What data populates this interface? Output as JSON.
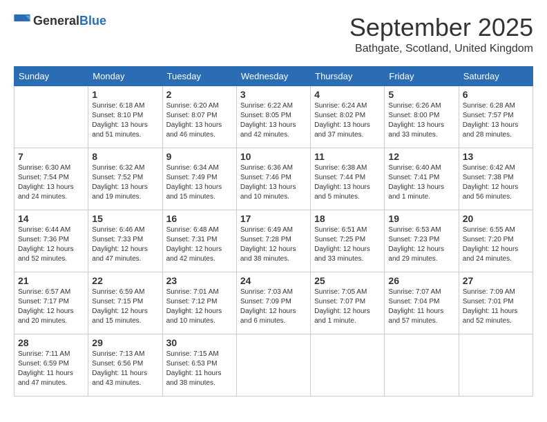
{
  "logo": {
    "general": "General",
    "blue": "Blue"
  },
  "title": "September 2025",
  "location": "Bathgate, Scotland, United Kingdom",
  "days_of_week": [
    "Sunday",
    "Monday",
    "Tuesday",
    "Wednesday",
    "Thursday",
    "Friday",
    "Saturday"
  ],
  "weeks": [
    [
      {
        "day": "",
        "info": ""
      },
      {
        "day": "1",
        "info": "Sunrise: 6:18 AM\nSunset: 8:10 PM\nDaylight: 13 hours\nand 51 minutes."
      },
      {
        "day": "2",
        "info": "Sunrise: 6:20 AM\nSunset: 8:07 PM\nDaylight: 13 hours\nand 46 minutes."
      },
      {
        "day": "3",
        "info": "Sunrise: 6:22 AM\nSunset: 8:05 PM\nDaylight: 13 hours\nand 42 minutes."
      },
      {
        "day": "4",
        "info": "Sunrise: 6:24 AM\nSunset: 8:02 PM\nDaylight: 13 hours\nand 37 minutes."
      },
      {
        "day": "5",
        "info": "Sunrise: 6:26 AM\nSunset: 8:00 PM\nDaylight: 13 hours\nand 33 minutes."
      },
      {
        "day": "6",
        "info": "Sunrise: 6:28 AM\nSunset: 7:57 PM\nDaylight: 13 hours\nand 28 minutes."
      }
    ],
    [
      {
        "day": "7",
        "info": "Sunrise: 6:30 AM\nSunset: 7:54 PM\nDaylight: 13 hours\nand 24 minutes."
      },
      {
        "day": "8",
        "info": "Sunrise: 6:32 AM\nSunset: 7:52 PM\nDaylight: 13 hours\nand 19 minutes."
      },
      {
        "day": "9",
        "info": "Sunrise: 6:34 AM\nSunset: 7:49 PM\nDaylight: 13 hours\nand 15 minutes."
      },
      {
        "day": "10",
        "info": "Sunrise: 6:36 AM\nSunset: 7:46 PM\nDaylight: 13 hours\nand 10 minutes."
      },
      {
        "day": "11",
        "info": "Sunrise: 6:38 AM\nSunset: 7:44 PM\nDaylight: 13 hours\nand 5 minutes."
      },
      {
        "day": "12",
        "info": "Sunrise: 6:40 AM\nSunset: 7:41 PM\nDaylight: 13 hours\nand 1 minute."
      },
      {
        "day": "13",
        "info": "Sunrise: 6:42 AM\nSunset: 7:38 PM\nDaylight: 12 hours\nand 56 minutes."
      }
    ],
    [
      {
        "day": "14",
        "info": "Sunrise: 6:44 AM\nSunset: 7:36 PM\nDaylight: 12 hours\nand 52 minutes."
      },
      {
        "day": "15",
        "info": "Sunrise: 6:46 AM\nSunset: 7:33 PM\nDaylight: 12 hours\nand 47 minutes."
      },
      {
        "day": "16",
        "info": "Sunrise: 6:48 AM\nSunset: 7:31 PM\nDaylight: 12 hours\nand 42 minutes."
      },
      {
        "day": "17",
        "info": "Sunrise: 6:49 AM\nSunset: 7:28 PM\nDaylight: 12 hours\nand 38 minutes."
      },
      {
        "day": "18",
        "info": "Sunrise: 6:51 AM\nSunset: 7:25 PM\nDaylight: 12 hours\nand 33 minutes."
      },
      {
        "day": "19",
        "info": "Sunrise: 6:53 AM\nSunset: 7:23 PM\nDaylight: 12 hours\nand 29 minutes."
      },
      {
        "day": "20",
        "info": "Sunrise: 6:55 AM\nSunset: 7:20 PM\nDaylight: 12 hours\nand 24 minutes."
      }
    ],
    [
      {
        "day": "21",
        "info": "Sunrise: 6:57 AM\nSunset: 7:17 PM\nDaylight: 12 hours\nand 20 minutes."
      },
      {
        "day": "22",
        "info": "Sunrise: 6:59 AM\nSunset: 7:15 PM\nDaylight: 12 hours\nand 15 minutes."
      },
      {
        "day": "23",
        "info": "Sunrise: 7:01 AM\nSunset: 7:12 PM\nDaylight: 12 hours\nand 10 minutes."
      },
      {
        "day": "24",
        "info": "Sunrise: 7:03 AM\nSunset: 7:09 PM\nDaylight: 12 hours\nand 6 minutes."
      },
      {
        "day": "25",
        "info": "Sunrise: 7:05 AM\nSunset: 7:07 PM\nDaylight: 12 hours\nand 1 minute."
      },
      {
        "day": "26",
        "info": "Sunrise: 7:07 AM\nSunset: 7:04 PM\nDaylight: 11 hours\nand 57 minutes."
      },
      {
        "day": "27",
        "info": "Sunrise: 7:09 AM\nSunset: 7:01 PM\nDaylight: 11 hours\nand 52 minutes."
      }
    ],
    [
      {
        "day": "28",
        "info": "Sunrise: 7:11 AM\nSunset: 6:59 PM\nDaylight: 11 hours\nand 47 minutes."
      },
      {
        "day": "29",
        "info": "Sunrise: 7:13 AM\nSunset: 6:56 PM\nDaylight: 11 hours\nand 43 minutes."
      },
      {
        "day": "30",
        "info": "Sunrise: 7:15 AM\nSunset: 6:53 PM\nDaylight: 11 hours\nand 38 minutes."
      },
      {
        "day": "",
        "info": ""
      },
      {
        "day": "",
        "info": ""
      },
      {
        "day": "",
        "info": ""
      },
      {
        "day": "",
        "info": ""
      }
    ]
  ]
}
